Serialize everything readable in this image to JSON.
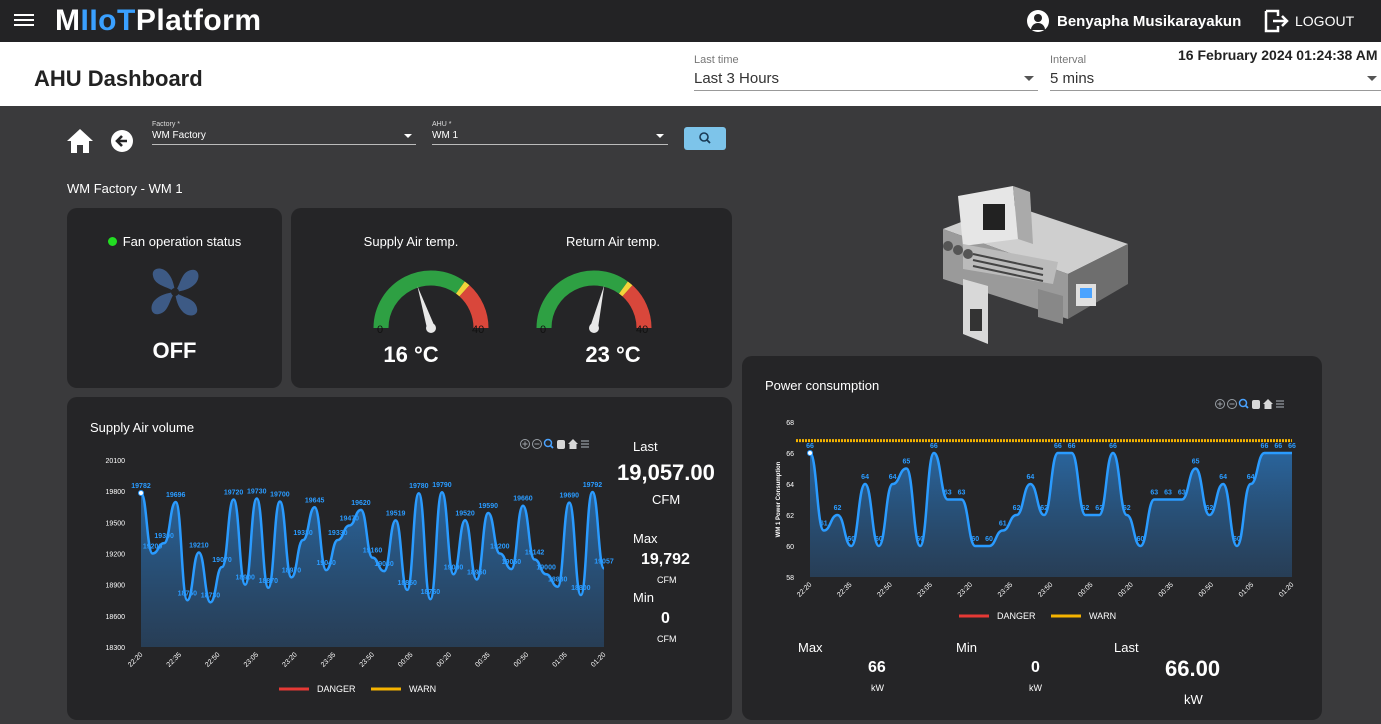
{
  "app": {
    "brand_prefix": "M",
    "brand_highlight": "IIoT",
    "brand_suffix": "Platform",
    "user": "Benyapha Musikarayakun",
    "logout_label": "LOGOUT"
  },
  "header": {
    "title": "AHU Dashboard",
    "last_time_label": "Last time",
    "last_time_value": "Last 3 Hours",
    "interval_label": "Interval",
    "interval_value": "5 mins",
    "datetime": "16 February 2024 01:24:38 AM"
  },
  "filters": {
    "factory_label": "Factory *",
    "factory_value": "WM Factory",
    "ahu_label": "AHU *",
    "ahu_value": "WM 1"
  },
  "breadcrumb": "WM Factory - WM 1",
  "fan": {
    "label": "Fan operation status",
    "state": "OFF",
    "status_color": "#22dd22"
  },
  "gauges": [
    {
      "label": "Supply Air temp.",
      "value": 16,
      "display": "16 °C",
      "min": 0,
      "max": 40,
      "min_label": "0",
      "max_label": "40"
    },
    {
      "label": "Return Air temp.",
      "value": 23,
      "display": "23 °C",
      "min": 0,
      "max": 40,
      "min_label": "0",
      "max_label": "40"
    }
  ],
  "supply": {
    "title": "Supply Air volume",
    "last_label": "Last",
    "last_value": "19,057.00",
    "last_unit": "CFM",
    "max_label": "Max",
    "max_value": "19,792",
    "max_unit": "CFM",
    "min_label": "Min",
    "min_value": "0",
    "min_unit": "CFM",
    "legend_danger": "DANGER",
    "legend_warn": "WARN"
  },
  "power": {
    "title": "Power consumption",
    "max_label": "Max",
    "max_value": "66",
    "max_unit": "kW",
    "min_label": "Min",
    "min_value": "0",
    "min_unit": "kW",
    "last_label": "Last",
    "last_value": "66.00",
    "last_unit": "kW",
    "legend_danger": "DANGER",
    "legend_warn": "WARN"
  },
  "colors": {
    "danger": "#e53935",
    "warn": "#f5b300",
    "line": "#2a9bff",
    "gauge_green": "#2ea043",
    "gauge_yellow": "#f2d43a",
    "gauge_red": "#d9473b"
  },
  "chart_data": [
    {
      "type": "area",
      "title": "Supply Air volume",
      "xlabel": "",
      "ylabel": "",
      "x_ticks": [
        "22:20",
        "22:35",
        "22:50",
        "23:05",
        "23:20",
        "23:35",
        "23:50",
        "00:05",
        "00:20",
        "00:35",
        "00:50",
        "01:05",
        "01:20"
      ],
      "ylim": [
        18300,
        20100
      ],
      "y_ticks": [
        18300,
        18600,
        18900,
        19200,
        19500,
        19800,
        20100
      ],
      "series": [
        {
          "values": [
            19782,
            19200,
            19300,
            19696,
            18750,
            19210,
            18730,
            19070,
            19720,
            18900,
            19730,
            18870,
            19700,
            18970,
            19330,
            19645,
            19040,
            19330,
            19470,
            19620,
            19160,
            19030,
            19519,
            18850,
            19780,
            18760,
            19790,
            19000,
            19520,
            18950,
            19590,
            19200,
            19050,
            19660,
            19142,
            19000,
            18880,
            19690,
            18800,
            19792,
            19057
          ]
        }
      ],
      "legend": [
        "DANGER",
        "WARN"
      ],
      "legend_position": "bottom",
      "grid": false
    },
    {
      "type": "area",
      "title": "Power consumption",
      "xlabel": "",
      "ylabel": "WM 1 Power Consumption",
      "x_ticks": [
        "22:20",
        "22:35",
        "22:50",
        "23:05",
        "23:20",
        "23:35",
        "23:50",
        "00:05",
        "00:20",
        "00:35",
        "00:50",
        "01:05",
        "01:20"
      ],
      "ylim": [
        58,
        68
      ],
      "y_ticks": [
        58,
        60,
        62,
        64,
        66,
        68
      ],
      "series": [
        {
          "values": [
            66,
            61,
            62,
            60,
            64,
            60,
            64,
            65,
            60,
            66,
            63,
            63,
            60,
            60,
            61,
            62,
            64,
            62,
            66,
            66,
            62,
            62,
            66,
            62,
            60,
            63,
            63,
            63,
            65,
            62,
            64,
            60,
            64,
            66,
            66,
            66
          ]
        }
      ],
      "warn_line": 66.8,
      "legend": [
        "DANGER",
        "WARN"
      ],
      "legend_position": "bottom",
      "grid": false
    }
  ]
}
